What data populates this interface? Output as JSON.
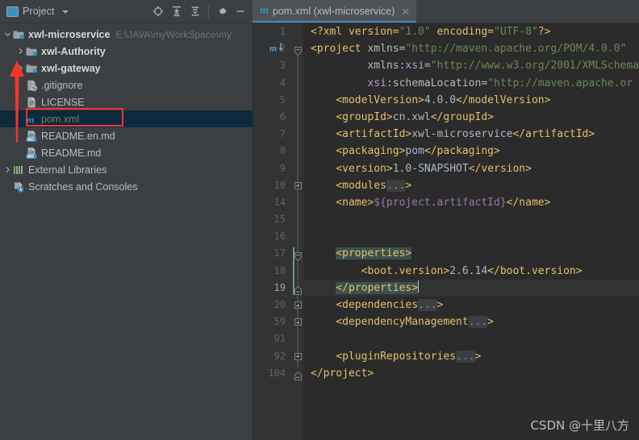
{
  "toolwindow": {
    "title": "Project",
    "dropdown_icon": "chevron-down-icon",
    "actions": [
      {
        "name": "locate-icon",
        "tip": "Select Opened File"
      },
      {
        "name": "expand-all-icon",
        "tip": "Expand All"
      },
      {
        "name": "collapse-all-icon",
        "tip": "Collapse All"
      },
      {
        "name": "gear-icon",
        "tip": "Settings"
      },
      {
        "name": "minimize-icon",
        "tip": "Hide"
      }
    ]
  },
  "tree": [
    {
      "label": "xwl-microservice",
      "path_hint": "E:\\JAVA\\myWorkSpace\\my",
      "icon": "module-folder-icon",
      "arrow": "expanded",
      "indent": 0,
      "bold": true,
      "selected": false
    },
    {
      "label": "xwl-Authority",
      "path_hint": "",
      "icon": "module-folder-icon",
      "arrow": "collapsed",
      "indent": 1,
      "bold": true,
      "selected": false
    },
    {
      "label": "xwl-gateway",
      "path_hint": "",
      "icon": "module-folder-icon",
      "arrow": "collapsed",
      "indent": 1,
      "bold": true,
      "selected": false
    },
    {
      "label": ".gitignore",
      "path_hint": "",
      "icon": "gitignore-file-icon",
      "arrow": "none",
      "indent": 1,
      "bold": false,
      "selected": false
    },
    {
      "label": "LICENSE",
      "path_hint": "",
      "icon": "text-file-icon",
      "arrow": "none",
      "indent": 1,
      "bold": false,
      "selected": false
    },
    {
      "label": "pom.xml",
      "path_hint": "",
      "icon": "maven-file-icon",
      "arrow": "none",
      "indent": 1,
      "bold": false,
      "selected": true,
      "highlighted": true
    },
    {
      "label": "README.en.md",
      "path_hint": "",
      "icon": "markdown-file-icon",
      "arrow": "none",
      "indent": 1,
      "bold": false,
      "selected": false
    },
    {
      "label": "README.md",
      "path_hint": "",
      "icon": "markdown-file-icon",
      "arrow": "none",
      "indent": 1,
      "bold": false,
      "selected": false
    },
    {
      "label": "External Libraries",
      "path_hint": "",
      "icon": "libraries-icon",
      "arrow": "collapsed",
      "indent": 0,
      "bold": false,
      "selected": false
    },
    {
      "label": "Scratches and Consoles",
      "path_hint": "",
      "icon": "scratches-icon",
      "arrow": "none",
      "indent": 0,
      "bold": false,
      "selected": false
    }
  ],
  "editor": {
    "tab": {
      "label": "pom.xml (xwl-microservice)",
      "icon": "maven-file-icon",
      "close_icon": "close-icon",
      "active": true
    },
    "line_numbers": [
      "1",
      "2",
      "3",
      "4",
      "5",
      "6",
      "7",
      "8",
      "9",
      "10",
      "14",
      "15",
      "16",
      "17",
      "18",
      "19",
      "20",
      "59",
      "91",
      "92",
      "104"
    ],
    "current_line_index": 15,
    "lines": [
      {
        "n": "1",
        "fold": "none",
        "tokens": [
          {
            "t": "<?xml version=",
            "c": "pi"
          },
          {
            "t": "\"1.0\"",
            "c": "val"
          },
          {
            "t": " encoding=",
            "c": "pi"
          },
          {
            "t": "\"UTF-8\"",
            "c": "val"
          },
          {
            "t": "?>",
            "c": "pi"
          }
        ]
      },
      {
        "n": "2",
        "fold": "arrow-down",
        "tokens": [
          {
            "t": "<project ",
            "c": "tag"
          },
          {
            "t": "xmlns=",
            "c": "attr"
          },
          {
            "t": "\"http://maven.apache.org/POM/4.0.0\"",
            "c": "val"
          }
        ]
      },
      {
        "n": "3",
        "fold": "none",
        "tokens": [
          {
            "t": "         ",
            "c": "txt"
          },
          {
            "t": "xmlns:",
            "c": "attr"
          },
          {
            "t": "xsi",
            "c": "ns"
          },
          {
            "t": "=",
            "c": "attr"
          },
          {
            "t": "\"http://www.w3.org/2001/XMLSchema",
            "c": "val"
          }
        ]
      },
      {
        "n": "4",
        "fold": "none",
        "tokens": [
          {
            "t": "         ",
            "c": "txt"
          },
          {
            "t": "xsi",
            "c": "ns"
          },
          {
            "t": ":schemaLocation=",
            "c": "attr"
          },
          {
            "t": "\"http://maven.apache.or",
            "c": "val"
          }
        ]
      },
      {
        "n": "5",
        "fold": "none",
        "tokens": [
          {
            "t": "    ",
            "c": "txt"
          },
          {
            "t": "<modelVersion>",
            "c": "tag"
          },
          {
            "t": "4.0.0",
            "c": "txt"
          },
          {
            "t": "</modelVersion>",
            "c": "tag"
          }
        ]
      },
      {
        "n": "6",
        "fold": "none",
        "tokens": [
          {
            "t": "    ",
            "c": "txt"
          },
          {
            "t": "<groupId>",
            "c": "tag"
          },
          {
            "t": "cn.xwl",
            "c": "txt"
          },
          {
            "t": "</groupId>",
            "c": "tag"
          }
        ]
      },
      {
        "n": "7",
        "fold": "none",
        "tokens": [
          {
            "t": "    ",
            "c": "txt"
          },
          {
            "t": "<artifactId>",
            "c": "tag"
          },
          {
            "t": "xwl-microservice",
            "c": "txt"
          },
          {
            "t": "</artifactId>",
            "c": "tag"
          }
        ]
      },
      {
        "n": "8",
        "fold": "none",
        "tokens": [
          {
            "t": "    ",
            "c": "txt"
          },
          {
            "t": "<packaging>",
            "c": "tag"
          },
          {
            "t": "pom",
            "c": "txt"
          },
          {
            "t": "</packaging>",
            "c": "tag"
          }
        ]
      },
      {
        "n": "9",
        "fold": "none",
        "tokens": [
          {
            "t": "    ",
            "c": "txt"
          },
          {
            "t": "<version>",
            "c": "tag"
          },
          {
            "t": "1.0-SNAPSHOT",
            "c": "txt"
          },
          {
            "t": "</version>",
            "c": "tag"
          }
        ]
      },
      {
        "n": "10",
        "fold": "plus",
        "tokens": [
          {
            "t": "    ",
            "c": "txt"
          },
          {
            "t": "<modules",
            "c": "tag"
          },
          {
            "t": "...",
            "c": "fold-ph"
          },
          {
            "t": ">",
            "c": "tag"
          }
        ]
      },
      {
        "n": "14",
        "fold": "none",
        "tokens": [
          {
            "t": "    ",
            "c": "txt"
          },
          {
            "t": "<name>",
            "c": "tag"
          },
          {
            "t": "${project.artifactId}",
            "c": "macro"
          },
          {
            "t": "</name>",
            "c": "tag"
          }
        ]
      },
      {
        "n": "15",
        "fold": "none",
        "tokens": []
      },
      {
        "n": "16",
        "fold": "none",
        "tokens": []
      },
      {
        "n": "17",
        "fold": "arrow-down",
        "stripe": true,
        "tokens": [
          {
            "t": "    ",
            "c": "txt"
          },
          {
            "t": "<properties>",
            "c": "tag hl-brace"
          }
        ]
      },
      {
        "n": "18",
        "fold": "none",
        "stripe": true,
        "tokens": [
          {
            "t": "        ",
            "c": "txt"
          },
          {
            "t": "<boot.version>",
            "c": "tag"
          },
          {
            "t": "2.6.14",
            "c": "txt"
          },
          {
            "t": "</boot.version>",
            "c": "tag"
          }
        ]
      },
      {
        "n": "19",
        "fold": "arrow-up",
        "stripe": true,
        "current": true,
        "cursor": true,
        "tokens": [
          {
            "t": "    ",
            "c": "txt"
          },
          {
            "t": "</properties>",
            "c": "tag hl-brace"
          }
        ]
      },
      {
        "n": "20",
        "fold": "plus",
        "tokens": [
          {
            "t": "    ",
            "c": "txt"
          },
          {
            "t": "<dependencies",
            "c": "tag"
          },
          {
            "t": "...",
            "c": "fold-ph"
          },
          {
            "t": ">",
            "c": "tag"
          }
        ]
      },
      {
        "n": "59",
        "fold": "plus",
        "tokens": [
          {
            "t": "    ",
            "c": "txt"
          },
          {
            "t": "<dependencyManagement",
            "c": "tag"
          },
          {
            "t": "...",
            "c": "fold-ph"
          },
          {
            "t": ">",
            "c": "tag"
          }
        ]
      },
      {
        "n": "91",
        "fold": "none",
        "tokens": []
      },
      {
        "n": "92",
        "fold": "plus",
        "tokens": [
          {
            "t": "    ",
            "c": "txt"
          },
          {
            "t": "<pluginRepositories",
            "c": "tag"
          },
          {
            "t": "...",
            "c": "fold-ph"
          },
          {
            "t": ">",
            "c": "tag"
          }
        ]
      },
      {
        "n": "104",
        "fold": "arrow-up",
        "tokens": [
          {
            "t": "</project>",
            "c": "tag"
          }
        ]
      }
    ],
    "maven_gutter_marker": {
      "icon": "maven-reimport-icon",
      "line": "2"
    }
  },
  "watermark": "CSDN @十里八方",
  "annotations": {
    "arrow": {
      "name": "red-annotation-arrow",
      "color": "#f4352c",
      "points_to": "xwl-microservice"
    },
    "rect": {
      "name": "red-annotation-rect",
      "color": "#f4352c",
      "around": "pom.xml"
    }
  },
  "colors": {
    "accent": "#4a88c7",
    "tag": "#e8bf6a",
    "value": "#6a8759",
    "text": "#a9b7c6",
    "selection": "#0d293e",
    "annotation": "#f4352c"
  }
}
